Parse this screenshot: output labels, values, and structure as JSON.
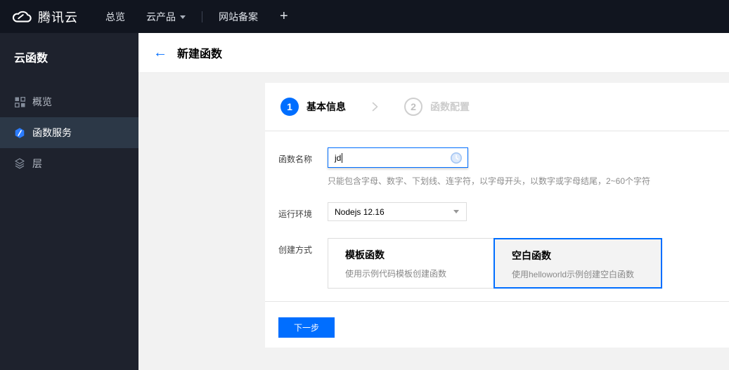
{
  "topbar": {
    "brand": "腾讯云",
    "nav": [
      {
        "label": "总览"
      },
      {
        "label": "云产品"
      },
      {
        "label": "网站备案"
      }
    ],
    "plus_label": "+"
  },
  "sidebar": {
    "title": "云函数",
    "items": [
      {
        "label": "概览",
        "icon": "grid-icon",
        "selected": false
      },
      {
        "label": "函数服务",
        "icon": "scf-hexagon-icon",
        "selected": true
      },
      {
        "label": "层",
        "icon": "layers-icon",
        "selected": false
      }
    ]
  },
  "header": {
    "back": "←",
    "title": "新建函数"
  },
  "steps": [
    {
      "num": "1",
      "label": "基本信息",
      "active": true
    },
    {
      "num": "2",
      "label": "函数配置",
      "active": false
    }
  ],
  "form": {
    "name": {
      "label": "函数名称",
      "value": "jd",
      "hint": "只能包含字母、数字、下划线、连字符，以字母开头，以数字或字母结尾，2~60个字符"
    },
    "runtime": {
      "label": "运行环境",
      "value": "Nodejs 12.16"
    },
    "method": {
      "label": "创建方式",
      "options": [
        {
          "title": "模板函数",
          "desc": "使用示例代码模板创建函数",
          "selected": false
        },
        {
          "title": "空白函数",
          "desc": "使用helloworld示例创建空白函数",
          "selected": true
        }
      ]
    }
  },
  "footer": {
    "next_label": "下一步"
  },
  "colors": {
    "accent": "#006eff",
    "topbar_bg": "#11151f",
    "sidebar_bg": "#1e222d",
    "sidebar_selected_bg": "#2c3847",
    "content_bg": "#f2f2f2",
    "step_inactive": "#cccccc"
  }
}
